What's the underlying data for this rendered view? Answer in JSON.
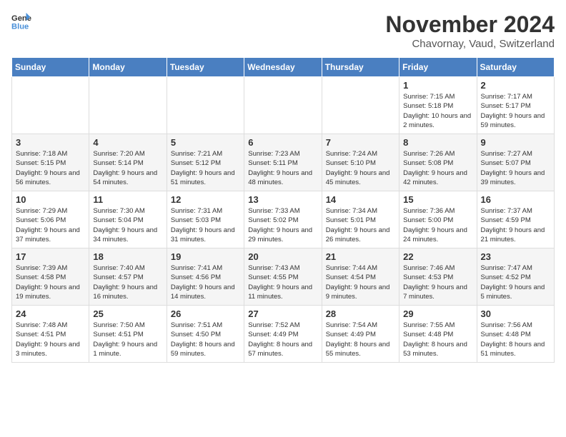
{
  "logo": {
    "line1": "General",
    "line2": "Blue"
  },
  "title": "November 2024",
  "location": "Chavornay, Vaud, Switzerland",
  "days_of_week": [
    "Sunday",
    "Monday",
    "Tuesday",
    "Wednesday",
    "Thursday",
    "Friday",
    "Saturday"
  ],
  "weeks": [
    [
      {
        "day": "",
        "info": ""
      },
      {
        "day": "",
        "info": ""
      },
      {
        "day": "",
        "info": ""
      },
      {
        "day": "",
        "info": ""
      },
      {
        "day": "",
        "info": ""
      },
      {
        "day": "1",
        "info": "Sunrise: 7:15 AM\nSunset: 5:18 PM\nDaylight: 10 hours and 2 minutes."
      },
      {
        "day": "2",
        "info": "Sunrise: 7:17 AM\nSunset: 5:17 PM\nDaylight: 9 hours and 59 minutes."
      }
    ],
    [
      {
        "day": "3",
        "info": "Sunrise: 7:18 AM\nSunset: 5:15 PM\nDaylight: 9 hours and 56 minutes."
      },
      {
        "day": "4",
        "info": "Sunrise: 7:20 AM\nSunset: 5:14 PM\nDaylight: 9 hours and 54 minutes."
      },
      {
        "day": "5",
        "info": "Sunrise: 7:21 AM\nSunset: 5:12 PM\nDaylight: 9 hours and 51 minutes."
      },
      {
        "day": "6",
        "info": "Sunrise: 7:23 AM\nSunset: 5:11 PM\nDaylight: 9 hours and 48 minutes."
      },
      {
        "day": "7",
        "info": "Sunrise: 7:24 AM\nSunset: 5:10 PM\nDaylight: 9 hours and 45 minutes."
      },
      {
        "day": "8",
        "info": "Sunrise: 7:26 AM\nSunset: 5:08 PM\nDaylight: 9 hours and 42 minutes."
      },
      {
        "day": "9",
        "info": "Sunrise: 7:27 AM\nSunset: 5:07 PM\nDaylight: 9 hours and 39 minutes."
      }
    ],
    [
      {
        "day": "10",
        "info": "Sunrise: 7:29 AM\nSunset: 5:06 PM\nDaylight: 9 hours and 37 minutes."
      },
      {
        "day": "11",
        "info": "Sunrise: 7:30 AM\nSunset: 5:04 PM\nDaylight: 9 hours and 34 minutes."
      },
      {
        "day": "12",
        "info": "Sunrise: 7:31 AM\nSunset: 5:03 PM\nDaylight: 9 hours and 31 minutes."
      },
      {
        "day": "13",
        "info": "Sunrise: 7:33 AM\nSunset: 5:02 PM\nDaylight: 9 hours and 29 minutes."
      },
      {
        "day": "14",
        "info": "Sunrise: 7:34 AM\nSunset: 5:01 PM\nDaylight: 9 hours and 26 minutes."
      },
      {
        "day": "15",
        "info": "Sunrise: 7:36 AM\nSunset: 5:00 PM\nDaylight: 9 hours and 24 minutes."
      },
      {
        "day": "16",
        "info": "Sunrise: 7:37 AM\nSunset: 4:59 PM\nDaylight: 9 hours and 21 minutes."
      }
    ],
    [
      {
        "day": "17",
        "info": "Sunrise: 7:39 AM\nSunset: 4:58 PM\nDaylight: 9 hours and 19 minutes."
      },
      {
        "day": "18",
        "info": "Sunrise: 7:40 AM\nSunset: 4:57 PM\nDaylight: 9 hours and 16 minutes."
      },
      {
        "day": "19",
        "info": "Sunrise: 7:41 AM\nSunset: 4:56 PM\nDaylight: 9 hours and 14 minutes."
      },
      {
        "day": "20",
        "info": "Sunrise: 7:43 AM\nSunset: 4:55 PM\nDaylight: 9 hours and 11 minutes."
      },
      {
        "day": "21",
        "info": "Sunrise: 7:44 AM\nSunset: 4:54 PM\nDaylight: 9 hours and 9 minutes."
      },
      {
        "day": "22",
        "info": "Sunrise: 7:46 AM\nSunset: 4:53 PM\nDaylight: 9 hours and 7 minutes."
      },
      {
        "day": "23",
        "info": "Sunrise: 7:47 AM\nSunset: 4:52 PM\nDaylight: 9 hours and 5 minutes."
      }
    ],
    [
      {
        "day": "24",
        "info": "Sunrise: 7:48 AM\nSunset: 4:51 PM\nDaylight: 9 hours and 3 minutes."
      },
      {
        "day": "25",
        "info": "Sunrise: 7:50 AM\nSunset: 4:51 PM\nDaylight: 9 hours and 1 minute."
      },
      {
        "day": "26",
        "info": "Sunrise: 7:51 AM\nSunset: 4:50 PM\nDaylight: 8 hours and 59 minutes."
      },
      {
        "day": "27",
        "info": "Sunrise: 7:52 AM\nSunset: 4:49 PM\nDaylight: 8 hours and 57 minutes."
      },
      {
        "day": "28",
        "info": "Sunrise: 7:54 AM\nSunset: 4:49 PM\nDaylight: 8 hours and 55 minutes."
      },
      {
        "day": "29",
        "info": "Sunrise: 7:55 AM\nSunset: 4:48 PM\nDaylight: 8 hours and 53 minutes."
      },
      {
        "day": "30",
        "info": "Sunrise: 7:56 AM\nSunset: 4:48 PM\nDaylight: 8 hours and 51 minutes."
      }
    ]
  ]
}
